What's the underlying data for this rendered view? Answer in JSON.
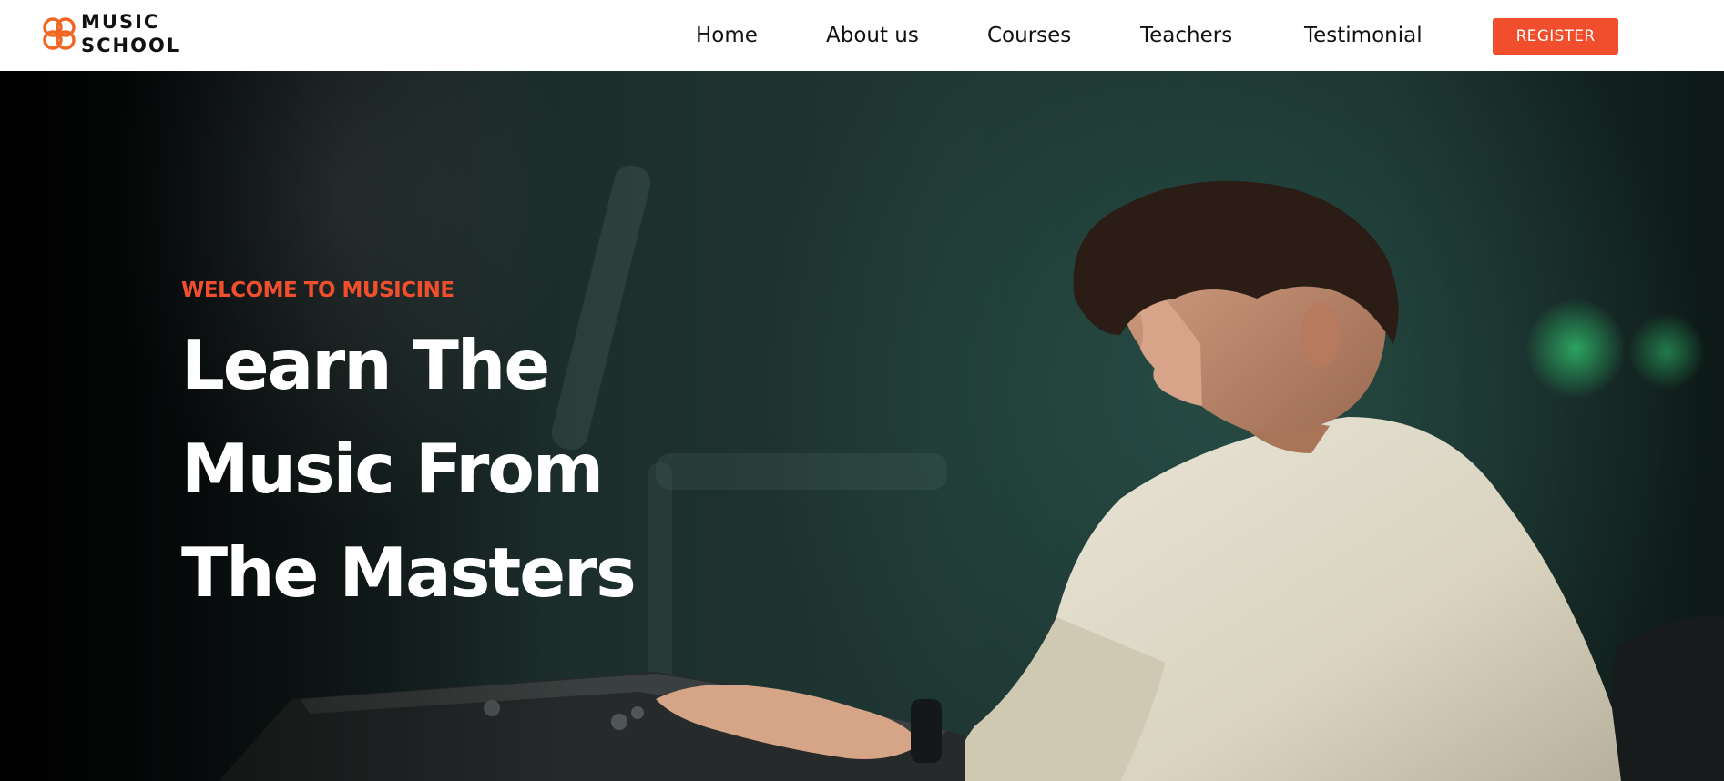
{
  "header": {
    "logo": {
      "icon": "flower-logo-icon",
      "line1": "MUSIC",
      "line2": "SCHOOL"
    },
    "nav": [
      {
        "label": "Home"
      },
      {
        "label": "About us"
      },
      {
        "label": "Courses"
      },
      {
        "label": "Teachers"
      },
      {
        "label": "Testimonial"
      }
    ],
    "register_label": "REGISTER"
  },
  "hero": {
    "eyebrow": "WELCOME TO MUSICINE",
    "headline": [
      "Learn The",
      "Music From",
      "The Masters"
    ],
    "image": "photo of a young man playing a keyboard"
  },
  "colors": {
    "accent": "#f04e2c",
    "text_dark": "#111111",
    "hero_bg": "#1f3632"
  }
}
